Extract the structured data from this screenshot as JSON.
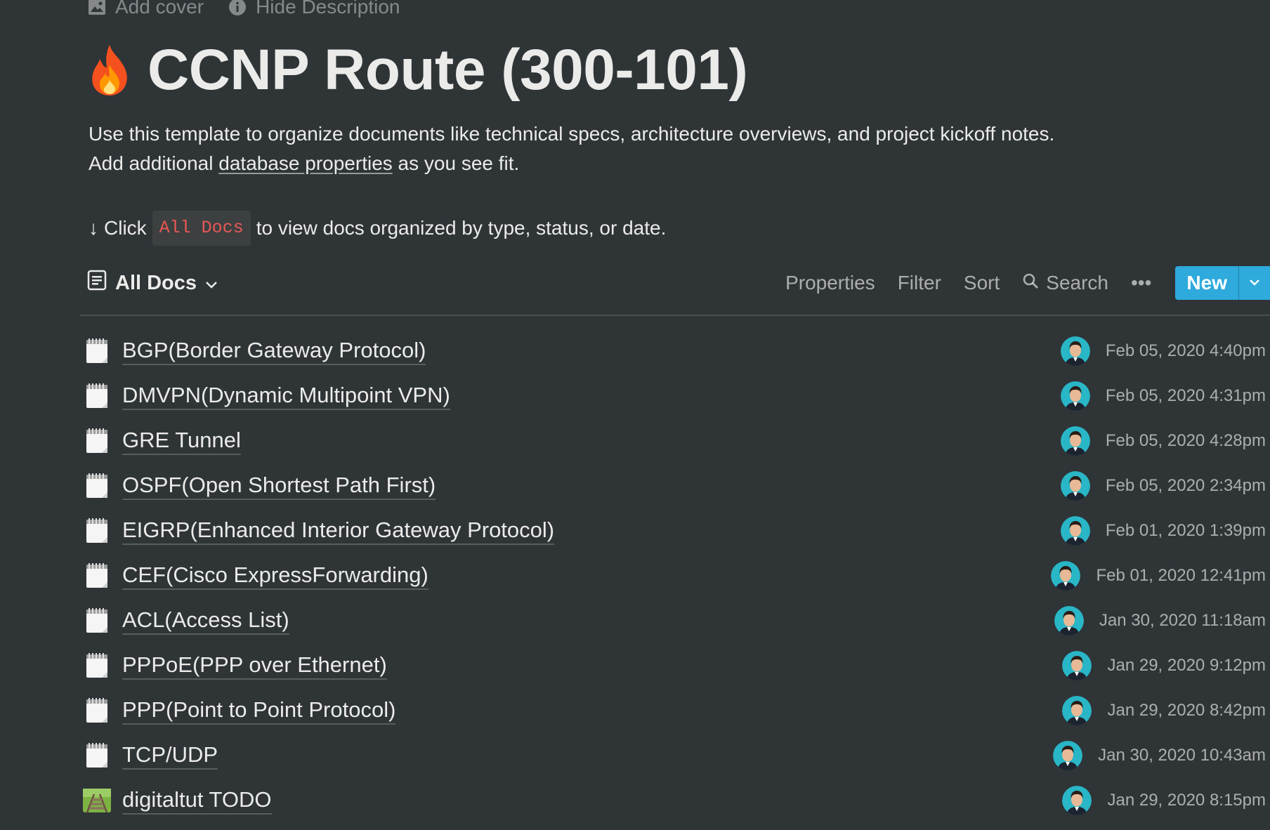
{
  "top_controls": {
    "add_cover": "Add cover",
    "hide_description": "Hide Description"
  },
  "header": {
    "emoji": "fire-icon",
    "title": "CCNP Route (300-101)"
  },
  "description": {
    "line1": "Use this template to organize documents like technical specs, architecture overviews, and project kickoff notes.",
    "line2_prefix": "Add additional ",
    "line2_link": "database properties",
    "line2_suffix": " as you see fit."
  },
  "hint": {
    "arrow": "↓",
    "prefix": "Click",
    "code": "All Docs",
    "suffix": "to view docs organized by type, status, or date."
  },
  "toolbar": {
    "view_name": "All Docs",
    "properties": "Properties",
    "filter": "Filter",
    "sort": "Sort",
    "search": "Search",
    "more": "•••",
    "new_label": "New",
    "accent_color": "#2eaadc"
  },
  "docs": [
    {
      "title": "BGP(Border Gateway Protocol)",
      "date": "Feb 05, 2020 4:40pm",
      "icon": "notepad-icon"
    },
    {
      "title": "DMVPN(Dynamic Multipoint VPN)",
      "date": "Feb 05, 2020 4:31pm",
      "icon": "notepad-icon"
    },
    {
      "title": "GRE Tunnel",
      "date": "Feb 05, 2020 4:28pm",
      "icon": "notepad-icon"
    },
    {
      "title": "OSPF(Open Shortest Path First)",
      "date": "Feb 05, 2020 2:34pm",
      "icon": "notepad-icon"
    },
    {
      "title": "EIGRP(Enhanced Interior Gateway Protocol)",
      "date": "Feb 01, 2020 1:39pm",
      "icon": "notepad-icon"
    },
    {
      "title": "CEF(Cisco ExpressForwarding)",
      "date": "Feb 01, 2020 12:41pm",
      "icon": "notepad-icon"
    },
    {
      "title": "ACL(Access List)",
      "date": "Jan 30, 2020 11:18am",
      "icon": "notepad-icon"
    },
    {
      "title": "PPPoE(PPP over Ethernet)",
      "date": "Jan 29, 2020 9:12pm",
      "icon": "notepad-icon"
    },
    {
      "title": "PPP(Point to Point Protocol)",
      "date": "Jan 29, 2020 8:42pm",
      "icon": "notepad-icon"
    },
    {
      "title": "TCP/UDP",
      "date": "Jan 30, 2020 10:43am",
      "icon": "notepad-icon"
    },
    {
      "title": "digitaltut TODO",
      "date": "Jan 29, 2020 8:15pm",
      "icon": "railway-track-icon"
    }
  ]
}
